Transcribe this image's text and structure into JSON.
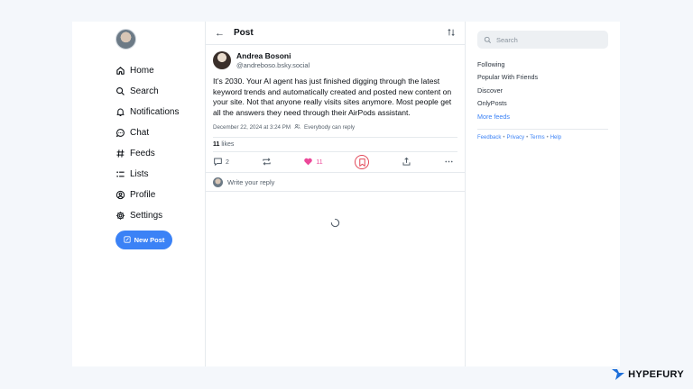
{
  "nav": {
    "items": [
      {
        "label": "Home",
        "icon": "home-icon"
      },
      {
        "label": "Search",
        "icon": "search-icon"
      },
      {
        "label": "Notifications",
        "icon": "bell-icon"
      },
      {
        "label": "Chat",
        "icon": "chat-icon"
      },
      {
        "label": "Feeds",
        "icon": "hash-icon"
      },
      {
        "label": "Lists",
        "icon": "list-icon"
      },
      {
        "label": "Profile",
        "icon": "profile-icon"
      },
      {
        "label": "Settings",
        "icon": "gear-icon"
      }
    ],
    "new_post": "New Post"
  },
  "header": {
    "title": "Post"
  },
  "post": {
    "author_name": "Andrea Bosoni",
    "author_handle": "@andreboso.bsky.social",
    "text": "It’s 2030. Your AI agent has just finished digging through the latest keyword trends and automatically created and posted new content on your site. Not that anyone really visits sites anymore. Most people get all the answers they need through their AirPods assistant.",
    "timestamp": "December 22, 2024 at 3:24 PM",
    "audience": "Everybody can reply",
    "likes_count": "11",
    "likes_label": "likes",
    "reply_count": "2",
    "heart_count": "11"
  },
  "reply": {
    "placeholder": "Write your reply"
  },
  "sidebar": {
    "search_placeholder": "Search",
    "feeds": [
      "Following",
      "Popular With Friends",
      "Discover",
      "OnlyPosts"
    ],
    "more_feeds": "More feeds",
    "footer": [
      "Feedback",
      "Privacy",
      "Terms",
      "Help"
    ],
    "footer_sep": "•"
  },
  "brand": {
    "name": "HYPEFURY"
  },
  "colors": {
    "accent": "#3b82f6",
    "heart": "#ec4899",
    "bookmark_ring": "#e24a5a"
  }
}
